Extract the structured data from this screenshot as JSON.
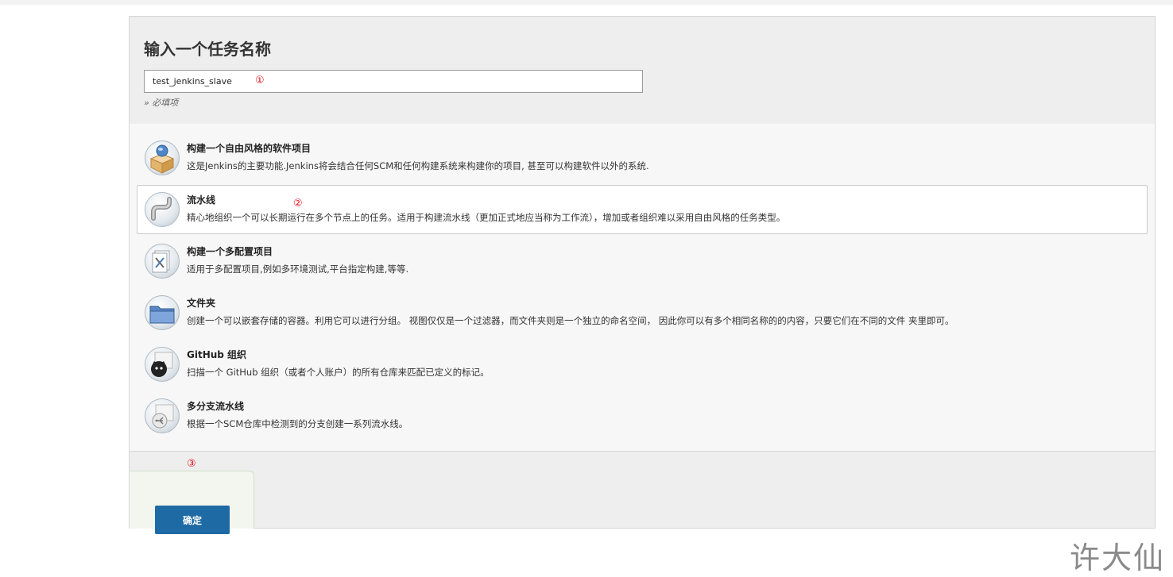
{
  "header": {
    "title": "输入一个任务名称",
    "name_input_value": "test_jenkins_slave",
    "required_hint": "» 必填项"
  },
  "annotations": {
    "a1": "①",
    "a2": "②",
    "a3": "③"
  },
  "items": [
    {
      "title": "构建一个自由风格的软件项目",
      "desc": "这是Jenkins的主要功能.Jenkins将会结合任何SCM和任何构建系统来构建你的项目, 甚至可以构建软件以外的系统.",
      "icon": "freestyle-box-icon",
      "selected": false
    },
    {
      "title": "流水线",
      "desc": "精心地组织一个可以长期运行在多个节点上的任务。适用于构建流水线（更加正式地应当称为工作流），增加或者组织难以采用自由风格的任务类型。",
      "icon": "pipeline-icon",
      "selected": true
    },
    {
      "title": "构建一个多配置项目",
      "desc": "适用于多配置项目,例如多环境测试,平台指定构建,等等.",
      "icon": "multiconfig-icon",
      "selected": false
    },
    {
      "title": "文件夹",
      "desc": "创建一个可以嵌套存储的容器。利用它可以进行分组。 视图仅仅是一个过滤器，而文件夹则是一个独立的命名空间， 因此你可以有多个相同名称的的内容，只要它们在不同的文件 夹里即可。",
      "icon": "folder-icon",
      "selected": false
    },
    {
      "title": "GitHub 组织",
      "desc": "扫描一个 GitHub 组织（或者个人账户）的所有仓库来匹配已定义的标记。",
      "icon": "github-icon",
      "selected": false
    },
    {
      "title": "多分支流水线",
      "desc": "根据一个SCM仓库中检测到的分支创建一系列流水线。",
      "icon": "multibranch-icon",
      "selected": false
    }
  ],
  "footer": {
    "ok_label": "确定"
  },
  "watermark": "许大仙",
  "colors": {
    "accent_button": "#1e6aa5",
    "annotation_red": "#e0161d"
  }
}
